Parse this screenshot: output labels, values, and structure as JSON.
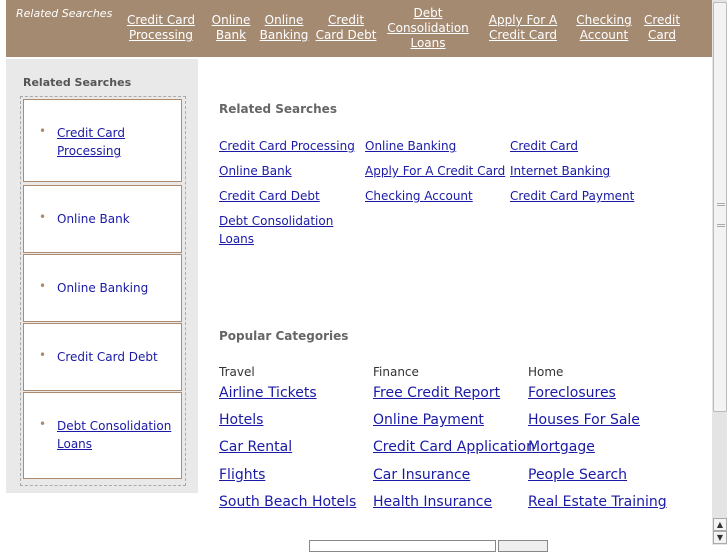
{
  "top": {
    "related_label": "Related Searches",
    "links": [
      "Credit Card Processing",
      "Online Bank",
      "Online Banking",
      "Credit Card Debt",
      "Debt Consolidation Loans",
      "Apply For A Credit Card",
      "Checking Account",
      "Credit Card"
    ]
  },
  "sidebar": {
    "header": "Related Searches",
    "items": [
      "Credit Card Processing",
      "Online Bank",
      "Online Banking",
      "Credit Card Debt",
      "Debt Consolidation Loans"
    ]
  },
  "main": {
    "related_header": "Related Searches",
    "related_links": [
      "Credit Card Processing",
      "Online Banking",
      "Credit Card",
      "Online Bank",
      "Apply For A Credit Card",
      "Internet Banking",
      "Credit Card Debt",
      "Checking Account",
      "Credit Card Payment",
      "Debt Consolidation Loans"
    ],
    "popular_header": "Popular Categories",
    "categories": [
      {
        "name": "Travel",
        "links": [
          "Airline Tickets",
          "Hotels",
          "Car Rental",
          "Flights",
          "South Beach Hotels"
        ]
      },
      {
        "name": "Finance",
        "links": [
          "Free Credit Report",
          "Online Payment",
          "Credit Card Application",
          "Car Insurance",
          "Health Insurance"
        ]
      },
      {
        "name": "Home",
        "links": [
          "Foreclosures",
          "Houses For Sale",
          "Mortgage",
          "People Search",
          "Real Estate Training"
        ]
      }
    ]
  },
  "icons": {
    "scroll_up": "arrow-up-icon",
    "scroll_down": "arrow-down-icon"
  }
}
